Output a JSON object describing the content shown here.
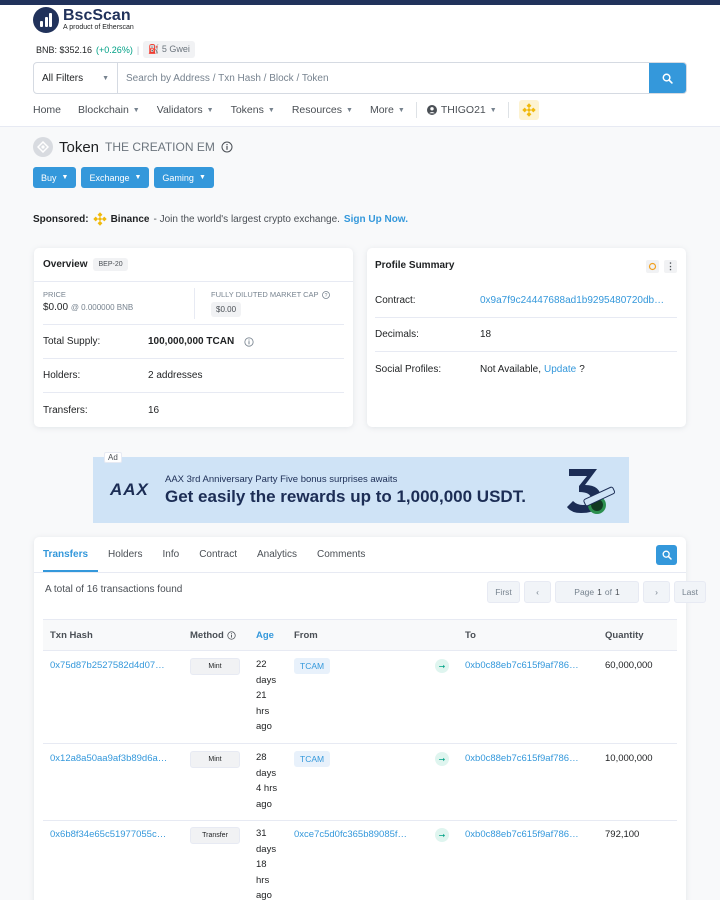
{
  "site": {
    "name": "BscScan",
    "tagline": "A product of Etherscan",
    "bnb_price_label": "BNB: $352.16",
    "bnb_change": "(+0.26%)",
    "gas": "5 Gwei"
  },
  "search": {
    "filter_label": "All Filters",
    "placeholder": "Search by Address / Txn Hash / Block / Token"
  },
  "nav": {
    "home": "Home",
    "blockchain": "Blockchain",
    "validators": "Validators",
    "tokens": "Tokens",
    "resources": "Resources",
    "more": "More",
    "user": "THIGO21"
  },
  "token": {
    "prefix": "Token",
    "name": "THE CREATION EM"
  },
  "actions": {
    "buy": "Buy",
    "exchange": "Exchange",
    "gaming": "Gaming"
  },
  "sponsored": {
    "label": "Sponsored:",
    "brand": "Binance",
    "text": "- Join the world's largest crypto exchange.",
    "cta": "Sign Up Now."
  },
  "overview": {
    "title": "Overview",
    "badge": "BEP-20",
    "price_label": "PRICE",
    "price_value": "$0.00",
    "price_bnb": "@ 0.000000 BNB",
    "mcap_label": "FULLY DILUTED MARKET CAP",
    "mcap_value": "$0.00",
    "supply_label": "Total Supply:",
    "supply_value": "100,000,000 TCAN",
    "holders_label": "Holders:",
    "holders_value": "2 addresses",
    "transfers_label": "Transfers:",
    "transfers_value": "16"
  },
  "profile": {
    "title": "Profile Summary",
    "contract_label": "Contract:",
    "contract_value": "0x9a7f9c24447688ad1b9295480720db…",
    "decimals_label": "Decimals:",
    "decimals_value": "18",
    "social_label": "Social Profiles:",
    "social_value": "Not Available,",
    "social_link": "Update",
    "social_q": "?"
  },
  "ad": {
    "label": "Ad",
    "brand": "AAX",
    "small": "AAX 3rd Anniversary Party  Five bonus surprises awaits",
    "big": "Get easily the rewards up to 1,000,000 USDT."
  },
  "tabs": [
    "Transfers",
    "Holders",
    "Info",
    "Contract",
    "Analytics",
    "Comments"
  ],
  "transfers": {
    "summary": "A total of 16 transactions found",
    "pager": {
      "first": "First",
      "page_prefix": "Page",
      "page_num": "1",
      "page_of": "of",
      "page_total": "1",
      "last": "Last"
    },
    "columns": [
      "Txn Hash",
      "Method",
      "Age",
      "From",
      "To",
      "Quantity"
    ],
    "rows": [
      {
        "hash": "0x75d87b2527582d4d07…",
        "method": "Mint",
        "age": "22 days 21 hrs ago",
        "from": "TCAM",
        "to": "0xb0c88eb7c615f9af786…",
        "qty": "60,000,000"
      },
      {
        "hash": "0x12a8a50aa9af3b89d6a…",
        "method": "Mint",
        "age": "28 days 4 hrs ago",
        "from": "TCAM",
        "to": "0xb0c88eb7c615f9af786…",
        "qty": "10,000,000"
      },
      {
        "hash": "0x6b8f34e65c51977055c…",
        "method": "Transfer",
        "age": "31 days 18 hrs ago",
        "from": "0xce7c5d0fc365b89085f…",
        "to": "0xb0c88eb7c615f9af786…",
        "qty": "792,100"
      }
    ]
  },
  "colors": {
    "accent": "#3498db",
    "brand": "#21325b",
    "positive": "#00a186",
    "bnb": "#f0b90b"
  },
  "icons": [
    "search-icon",
    "info-icon",
    "user-icon",
    "bnb-icon",
    "chevron-down-icon",
    "arrow-right-icon",
    "sun-icon",
    "more-vertical-icon"
  ]
}
